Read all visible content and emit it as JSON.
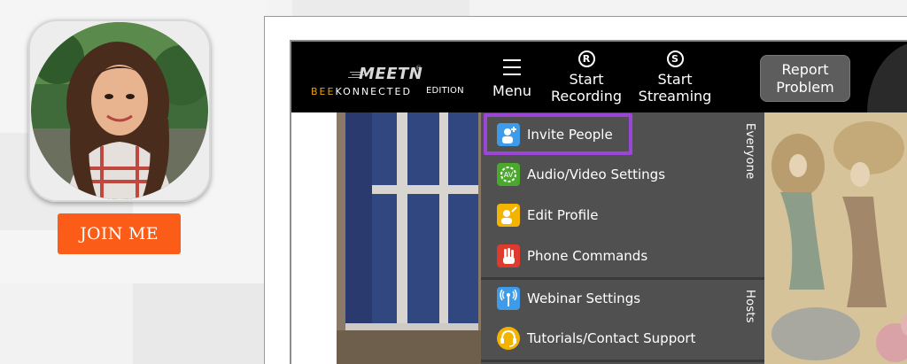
{
  "join_button": {
    "label": "JOIN ME"
  },
  "app": {
    "logo": {
      "brand": "MEETN",
      "registered": "®",
      "sub_accent": "BEE",
      "sub_rest": "KONNECTED",
      "edition": "EDITION"
    },
    "nav": {
      "menu": {
        "label": "Menu",
        "icon": "hamburger-icon"
      },
      "start_recording": {
        "line1": "Start",
        "line2": "Recording",
        "icon_glyph": "R"
      },
      "start_streaming": {
        "line1": "Start",
        "line2": "Streaming",
        "icon_glyph": "S"
      },
      "report_problem": {
        "line1": "Report",
        "line2": "Problem"
      }
    },
    "menu": {
      "groups": [
        {
          "label": "Everyone"
        },
        {
          "label": "Hosts"
        }
      ],
      "items": [
        {
          "label": "Invite People",
          "icon": "invite-people-icon",
          "color": "#3d9be9",
          "highlighted": true
        },
        {
          "label": "Audio/Video Settings",
          "icon": "audio-video-settings-icon",
          "color": "#4aa92d",
          "highlighted": false
        },
        {
          "label": "Edit Profile",
          "icon": "edit-profile-icon",
          "color": "#f2b400",
          "highlighted": false
        },
        {
          "label": "Phone Commands",
          "icon": "phone-commands-icon",
          "color": "#e03a2e",
          "highlighted": false
        },
        {
          "label": "Webinar Settings",
          "icon": "webinar-settings-icon",
          "color": "#3d9be9",
          "highlighted": false
        },
        {
          "label": "Tutorials/Contact Support",
          "icon": "tutorials-support-icon",
          "color": "#f2b400",
          "highlighted": false
        }
      ],
      "highlight_color": "#9b46d6"
    }
  },
  "colors": {
    "join_button": "#fb5d18",
    "topbar": "#000000",
    "menu_bg": "#505050"
  }
}
